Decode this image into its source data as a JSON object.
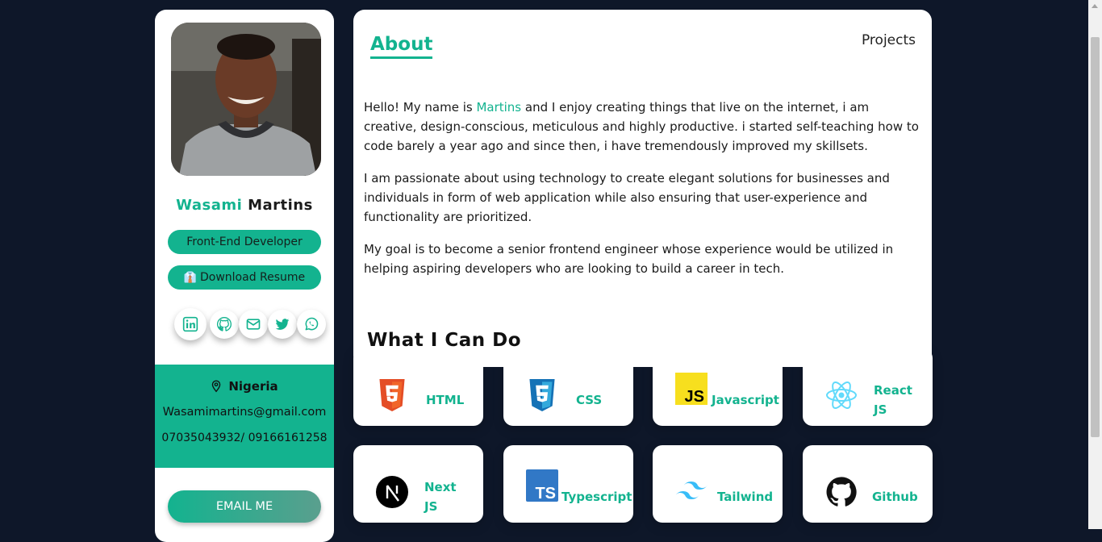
{
  "profile": {
    "first_name": "Wasami",
    "last_name": "Martins",
    "role": "Front-End Developer",
    "resume_label": "Download Resume",
    "resume_emoji": "👔"
  },
  "socials": [
    "linkedin-icon",
    "github-icon",
    "mail-icon",
    "twitter-icon",
    "whatsapp-icon"
  ],
  "contact": {
    "location": "Nigeria",
    "email": "Wasamimartins@gmail.com",
    "phone": "07035043932/ 09166161258"
  },
  "email_button": "EMAIL ME",
  "tabs": {
    "about": "About",
    "projects": "Projects"
  },
  "bio": {
    "p1_start": "Hello! My name is ",
    "p1_name": "Martins",
    "p1_end": " and I enjoy creating things that live on the internet, i am creative, design-conscious, meticulous and highly productive. i started self-teaching how to code barely a year ago and since then, i have tremendously improved my skillsets.",
    "p2": "I am passionate about using technology to create elegant solutions for businesses and individuals in form of web application while also ensuring that user-experience and functionality are prioritized.",
    "p3": "My goal is to become a senior frontend engineer whose experience would be utilized in helping aspiring developers who are looking to build a career in tech."
  },
  "what_i_can_do": "What I Can Do",
  "skills": [
    {
      "label": "HTML",
      "icon": "html5-icon"
    },
    {
      "label": "CSS",
      "icon": "css3-icon"
    },
    {
      "label": "Javascript",
      "icon": "javascript-icon"
    },
    {
      "label": "React JS",
      "icon": "react-icon"
    },
    {
      "label": "Next JS",
      "icon": "nextjs-icon"
    },
    {
      "label": "Typescript",
      "icon": "typescript-icon"
    },
    {
      "label": "Tailwind",
      "icon": "tailwind-icon"
    },
    {
      "label": "Github",
      "icon": "github-icon"
    }
  ],
  "colors": {
    "accent": "#13b38f",
    "background": "#0e1729"
  }
}
